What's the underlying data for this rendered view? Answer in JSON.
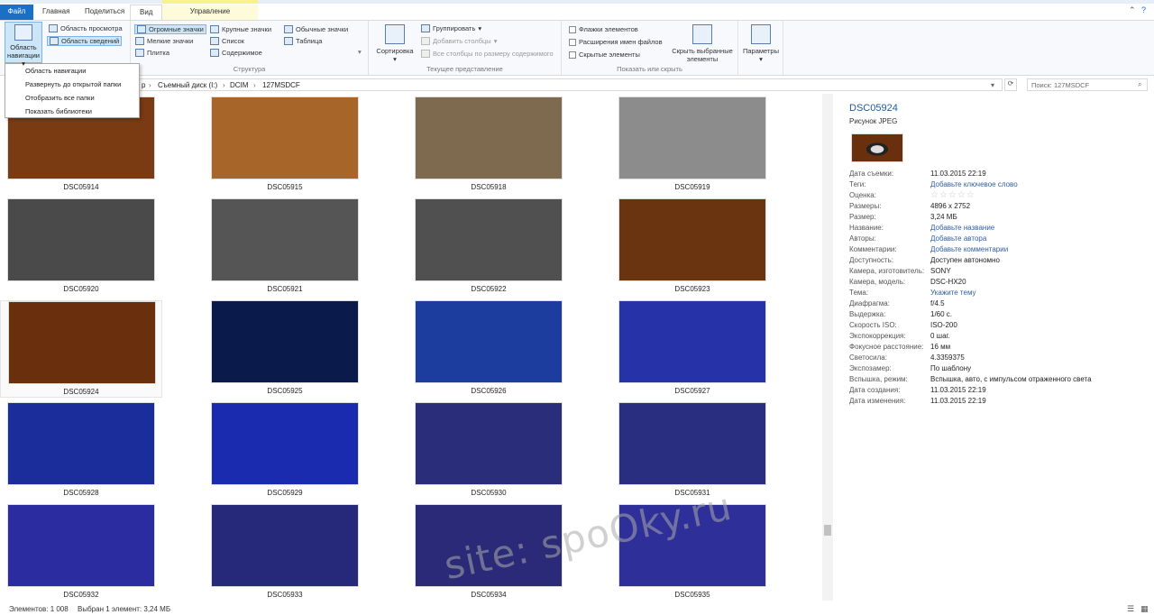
{
  "tabs": {
    "file": "Файл",
    "home": "Главная",
    "share": "Поделиться",
    "view": "Вид",
    "manage": "Управление"
  },
  "ribbon": {
    "panes": {
      "nav_pane": "Область навигации",
      "preview_pane": "Область просмотра",
      "details_pane": "Область сведений"
    },
    "layout": {
      "label": "Структура",
      "items": [
        "Огромные значки",
        "Крупные значки",
        "Обычные значки",
        "Мелкие значки",
        "Список",
        "Таблица",
        "Плитка",
        "Содержимое"
      ]
    },
    "current_view": {
      "label": "Текущее представление",
      "sort": "Сортировка",
      "group": "Группировать",
      "add_columns": "Добавить столбцы",
      "fit_columns": "Все столбцы по размеру содержимого"
    },
    "show_hide": {
      "label": "Показать или скрыть",
      "checkboxes": [
        "Флажки элементов",
        "Расширения имен файлов",
        "Скрытые элементы"
      ],
      "hide_selected": "Скрыть выбранные элементы"
    },
    "options": "Параметры"
  },
  "nav_menu": [
    "Область навигации",
    "Развернуть до открытой папки",
    "Отобразить все папки",
    "Показать библиотеки"
  ],
  "address": {
    "crumbs": [
      "р",
      "Съемный диск (I:)",
      "DCIM",
      "127MSDCF"
    ],
    "search_placeholder": "Поиск: 127MSDCF"
  },
  "files": [
    {
      "name": "DSC05914",
      "color": "#7a3a12"
    },
    {
      "name": "DSC05915",
      "color": "#a8652a"
    },
    {
      "name": "DSC05918",
      "color": "#7d6a4f"
    },
    {
      "name": "DSC05919",
      "color": "#8c8c8c"
    },
    {
      "name": "DSC05920",
      "color": "#4a4a4a"
    },
    {
      "name": "DSC05921",
      "color": "#555"
    },
    {
      "name": "DSC05922",
      "color": "#505050"
    },
    {
      "name": "DSC05923",
      "color": "#6b3410"
    },
    {
      "name": "DSC05924",
      "color": "#6a2f0c"
    },
    {
      "name": "DSC05925",
      "color": "#0a1a4a"
    },
    {
      "name": "DSC05926",
      "color": "#1d3d9e"
    },
    {
      "name": "DSC05927",
      "color": "#2633a8"
    },
    {
      "name": "DSC05928",
      "color": "#1b2d9a"
    },
    {
      "name": "DSC05929",
      "color": "#1a2bb0"
    },
    {
      "name": "DSC05930",
      "color": "#2a2e7a"
    },
    {
      "name": "DSC05931",
      "color": "#2a2e80"
    },
    {
      "name": "DSC05932",
      "color": "#2b2ca0"
    },
    {
      "name": "DSC05933",
      "color": "#26287a"
    },
    {
      "name": "DSC05934",
      "color": "#2a2a78"
    },
    {
      "name": "DSC05935",
      "color": "#2f2f9a"
    }
  ],
  "details": {
    "title": "DSC05924",
    "type": "Рисунок JPEG",
    "rows": [
      {
        "label": "Дата съемки:",
        "value": "11.03.2015 22:19"
      },
      {
        "label": "Теги:",
        "value": "Добавьте ключевое слово",
        "link": true
      },
      {
        "label": "Оценка:",
        "value": "",
        "stars": true
      },
      {
        "label": "Размеры:",
        "value": "4896 x 2752"
      },
      {
        "label": "Размер:",
        "value": "3,24 МБ"
      },
      {
        "label": "Название:",
        "value": "Добавьте название",
        "link": true
      },
      {
        "label": "Авторы:",
        "value": "Добавьте автора",
        "link": true
      },
      {
        "label": "Комментарии:",
        "value": "Добавьте комментарии",
        "link": true
      },
      {
        "label": "Доступность:",
        "value": "Доступен автономно"
      },
      {
        "label": "Камера, изготовитель:",
        "value": "SONY"
      },
      {
        "label": "Камера, модель:",
        "value": "DSC-HX20"
      },
      {
        "label": "Тема:",
        "value": "Укажите тему",
        "link": true
      },
      {
        "label": "Диафрагма:",
        "value": "f/4.5"
      },
      {
        "label": "Выдержка:",
        "value": "1/60 с."
      },
      {
        "label": "Скорость ISO:",
        "value": "ISO-200"
      },
      {
        "label": "Экспокоррекция:",
        "value": "0 шаг."
      },
      {
        "label": "Фокусное расстояние:",
        "value": "16 мм"
      },
      {
        "label": "Светосила:",
        "value": "4.3359375"
      },
      {
        "label": "Экспозамер:",
        "value": "По шаблону"
      },
      {
        "label": "Вспышка, режим:",
        "value": "Вспышка, авто, с импульсом отраженного света"
      },
      {
        "label": "Дата создания:",
        "value": "11.03.2015 22:19"
      },
      {
        "label": "Дата изменения:",
        "value": "11.03.2015 22:19"
      }
    ]
  },
  "status": {
    "count": "Элементов: 1 008",
    "selected": "Выбран 1 элемент: 3,24 МБ"
  },
  "watermark": "site: spoOky.ru"
}
